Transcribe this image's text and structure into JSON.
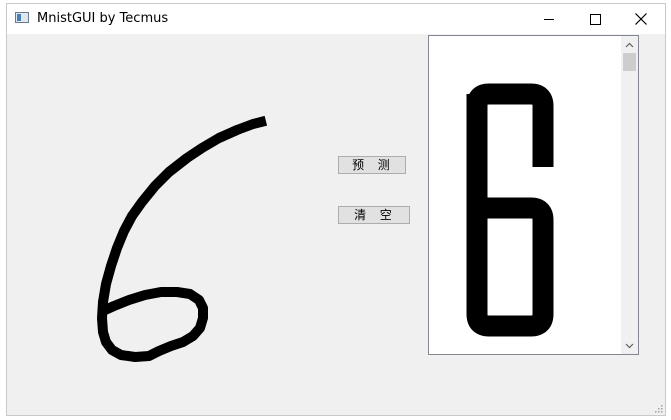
{
  "window": {
    "title": "MnistGUI by Tecmus"
  },
  "buttons": {
    "predict_label": "预  测",
    "clear_label": "清  空"
  },
  "icons": {
    "app": "app-window-icon",
    "minimize": "minimize-icon",
    "maximize": "maximize-icon",
    "close": "close-icon",
    "scroll_up": "chevron-up-icon",
    "scroll_down": "chevron-down-icon",
    "resize_grip": "resize-grip-icon"
  },
  "colors": {
    "titlebar": "#ffffff",
    "client": "#f0f0f0",
    "ink": "#000000",
    "button_face": "#e1e1e1",
    "button_border": "#adadad"
  }
}
